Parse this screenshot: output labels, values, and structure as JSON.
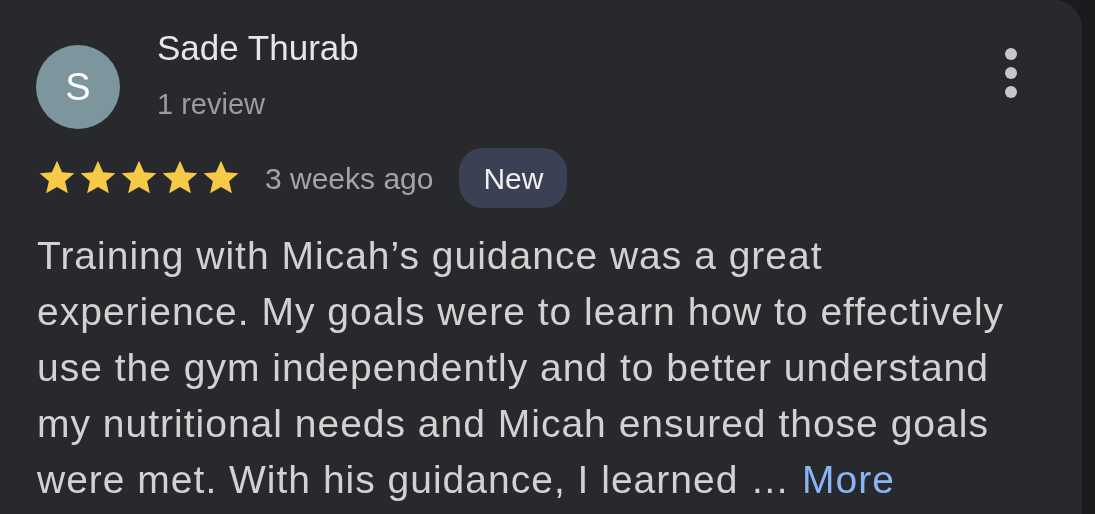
{
  "review": {
    "avatar_letter": "S",
    "author": "Sade Thurab",
    "author_reviews": "1 review",
    "stars": 5,
    "time": "3 weeks ago",
    "badge": "New",
    "body": "Training with Micah’s guidance was a great experience. My goals were to learn how to effectively use the gym independently and to better understand my nutritional needs and Micah ensured those goals were met. With his guidance, I learned …",
    "more_link": "More"
  }
}
